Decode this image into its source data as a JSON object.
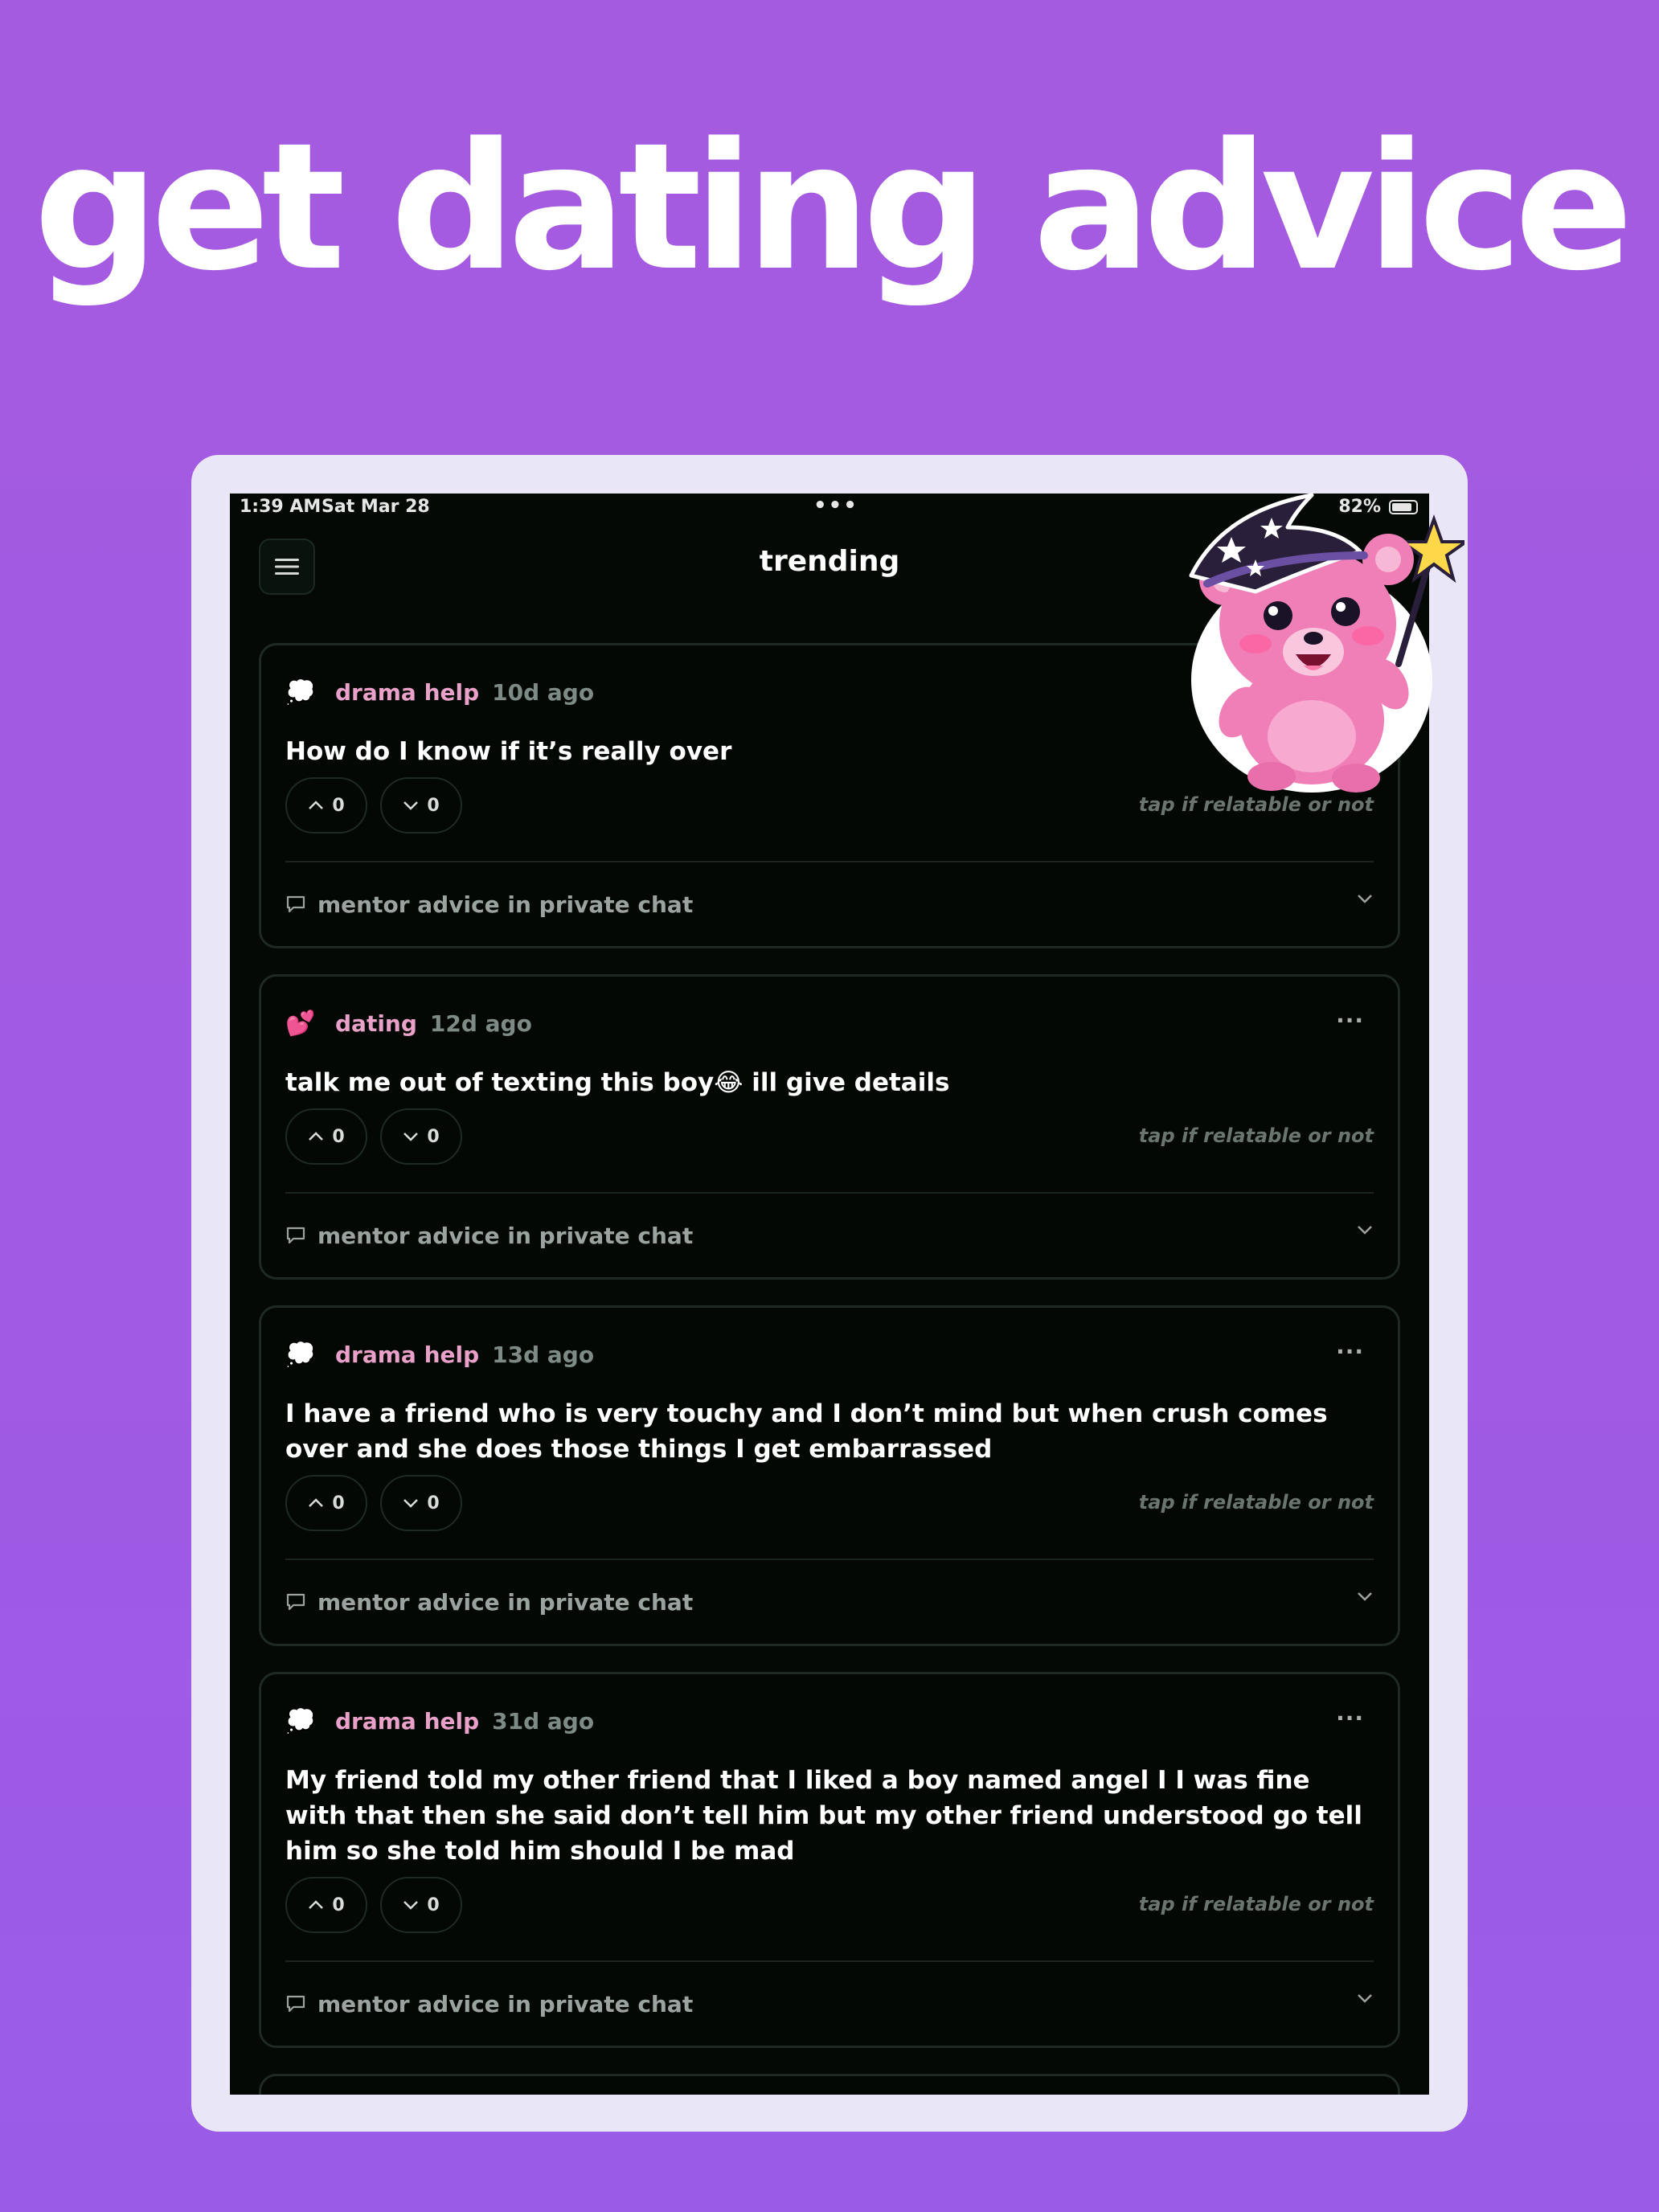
{
  "headline": "get dating advice",
  "status_bar": {
    "time": "1:39 AM",
    "date": "Sat Mar 28",
    "battery": "82%"
  },
  "header": {
    "title": "trending"
  },
  "posts": [
    {
      "category_emoji": "💭",
      "category": "drama help",
      "time": "10d ago",
      "text": "How do I know if it’s really over",
      "upvotes": "0",
      "downvotes": "0",
      "hint": "tap if relatable or not",
      "mentor_label": "mentor advice in private chat"
    },
    {
      "category_emoji": "💕",
      "category": "dating",
      "time": "12d ago",
      "more": "···",
      "text": "talk me out of texting this boy😂 ill give details",
      "upvotes": "0",
      "downvotes": "0",
      "hint": "tap if relatable or not",
      "mentor_label": "mentor advice in private chat"
    },
    {
      "category_emoji": "💭",
      "category": "drama help",
      "time": "13d ago",
      "more": "···",
      "text": "I have a friend who is very touchy and I don’t mind but when crush comes over and she does those things I get embarrassed",
      "upvotes": "0",
      "downvotes": "0",
      "hint": "tap if relatable or not",
      "mentor_label": "mentor advice in private chat"
    },
    {
      "category_emoji": "💭",
      "category": "drama help",
      "time": "31d ago",
      "more": "···",
      "text": "My friend told my other friend that I liked a boy named angel I I was fine with that then she said don’t tell him but my other friend understood go tell him so she told him should I be mad",
      "upvotes": "0",
      "downvotes": "0",
      "hint": "tap if relatable or not",
      "mentor_label": "mentor advice in private chat"
    }
  ]
}
